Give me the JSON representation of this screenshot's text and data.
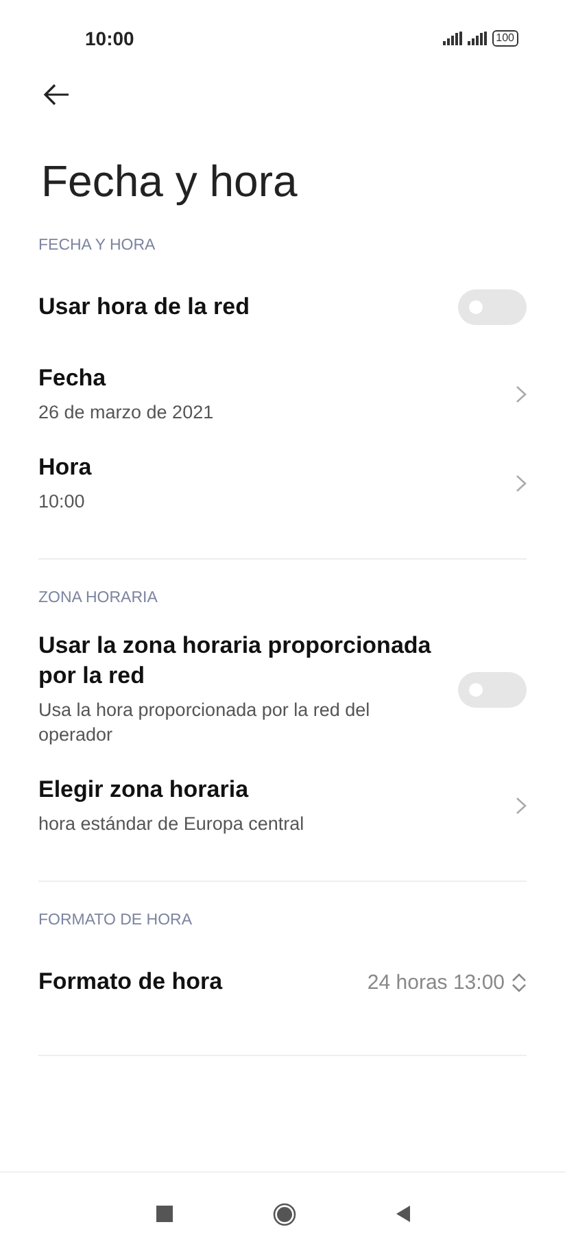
{
  "status_bar": {
    "time": "10:00",
    "battery": "100"
  },
  "title": "Fecha y hora",
  "sections": [
    {
      "header": "FECHA Y HORA",
      "items": [
        {
          "kind": "toggle",
          "label": "Usar hora de la red",
          "on": false
        },
        {
          "kind": "link",
          "label": "Fecha",
          "subtitle": "26 de marzo de 2021"
        },
        {
          "kind": "link",
          "label": "Hora",
          "subtitle": "10:00"
        }
      ]
    },
    {
      "header": "ZONA HORARIA",
      "items": [
        {
          "kind": "toggle",
          "label": "Usar la zona horaria proporcionada por la red",
          "subtitle": "Usa la hora proporcionada por la red del operador",
          "on": false
        },
        {
          "kind": "link",
          "label": "Elegir zona horaria",
          "subtitle": "hora estándar de Europa central"
        }
      ]
    },
    {
      "header": "FORMATO DE HORA",
      "items": [
        {
          "kind": "select",
          "label": "Formato de hora",
          "value": "24 horas 13:00"
        }
      ]
    }
  ]
}
